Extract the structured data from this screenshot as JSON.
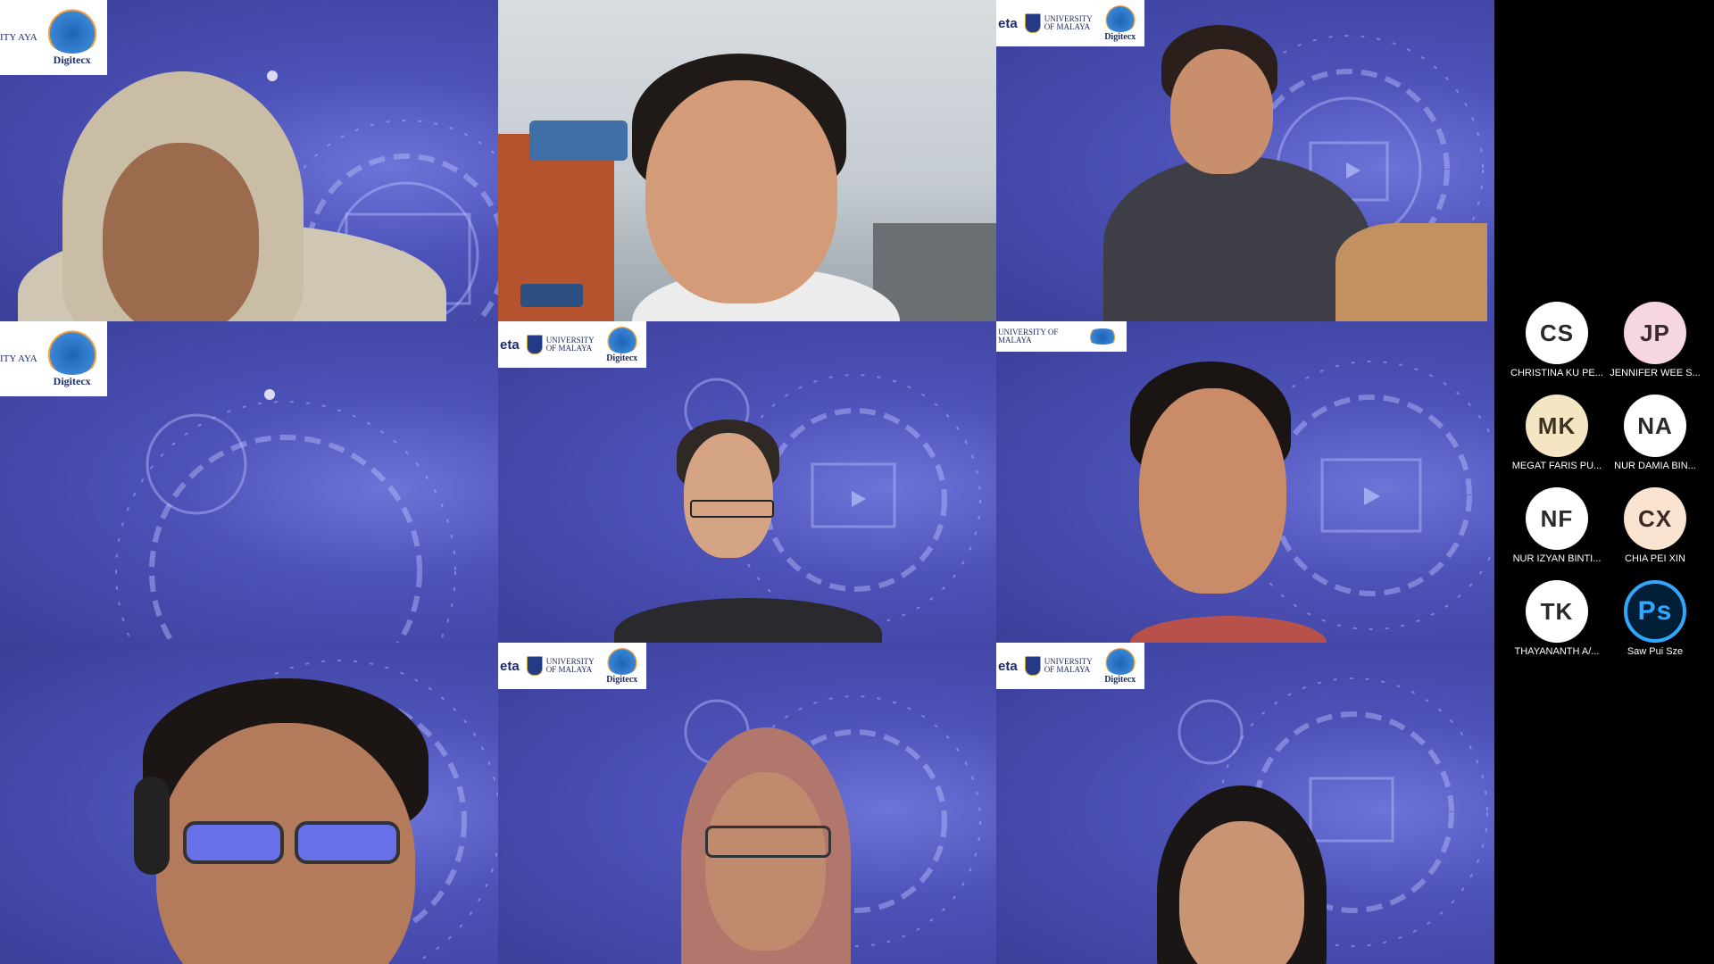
{
  "banners": {
    "left_fragment": "ITY AYA",
    "center_fragment": "eta",
    "university": "UNIVERSITY OF MALAYA",
    "digitex": "Digitecx"
  },
  "participants": [
    {
      "initials": "CS",
      "name": "CHRISTINA KU PE...",
      "color": "#ffffff",
      "text_color": "#2a2a2a"
    },
    {
      "initials": "JP",
      "name": "JENNIFER WEE S...",
      "color": "#f6d7df",
      "text_color": "#3a2a30"
    },
    {
      "initials": "MK",
      "name": "MEGAT FARIS PU...",
      "color": "#f5e6c3",
      "text_color": "#3b3222"
    },
    {
      "initials": "NA",
      "name": "NUR DAMIA BIN...",
      "color": "#ffffff",
      "text_color": "#2a2a2a"
    },
    {
      "initials": "NF",
      "name": "NUR IZYAN BINTI...",
      "color": "#ffffff",
      "text_color": "#2a2a2a"
    },
    {
      "initials": "CX",
      "name": "CHIA PEI XIN",
      "color": "#fbe3d2",
      "text_color": "#3a2a22"
    },
    {
      "initials": "TK",
      "name": "THAYANANTH A/...",
      "color": "#ffffff",
      "text_color": "#2a2a2a"
    },
    {
      "initials": "Ps",
      "name": "Saw Pui Sze",
      "icon": "photoshop-icon"
    }
  ]
}
